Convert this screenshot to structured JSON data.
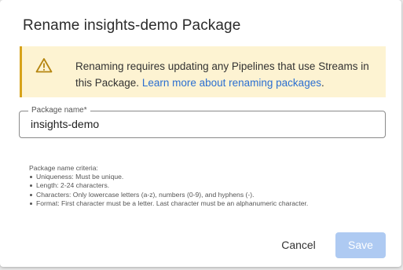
{
  "dialog": {
    "title": "Rename insights-demo Package",
    "warning": {
      "icon": "warning-triangle-icon",
      "text": "Renaming requires updating any Pipelines that use Streams in this Package.",
      "link": "Learn more about renaming packages",
      "suffix": "."
    },
    "field": {
      "label": "Package name*",
      "value": "insights-demo"
    },
    "criteria": {
      "heading": "Package name criteria:",
      "items": [
        "Uniqueness: Must be unique.",
        "Length: 2-24 characters.",
        "Characters: Only lowercase letters (a-z), numbers (0-9), and hyphens (-).",
        "Format: First character must be a letter. Last character must be an alphanumeric character."
      ]
    },
    "buttons": {
      "cancel": "Cancel",
      "save": "Save"
    }
  },
  "colors": {
    "warning_bg": "#fdf3d2",
    "warning_accent": "#d7a21a",
    "link": "#2b6fd1",
    "save_disabled": "#aecaf2"
  }
}
